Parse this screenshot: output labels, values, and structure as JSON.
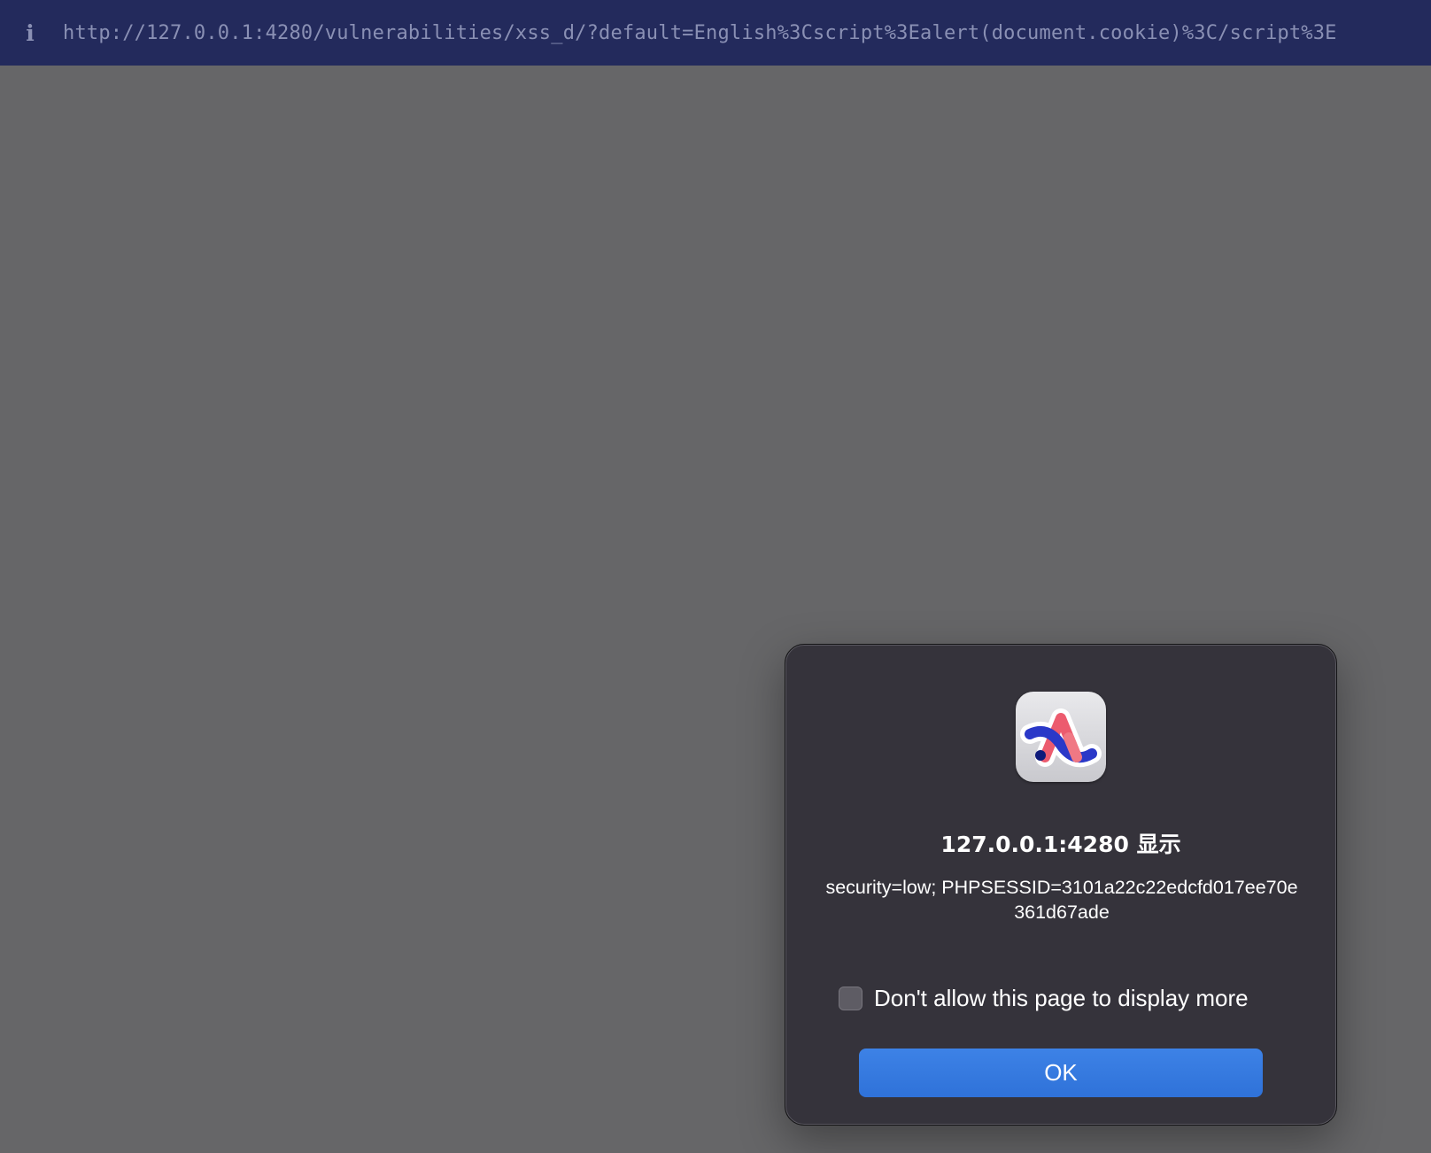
{
  "address_bar": {
    "info_icon": "i",
    "url": "http://127.0.0.1:4280/vulnerabilities/xss_d/?default=English%3Cscript%3Ealert(document.cookie)%3C/script%3E"
  },
  "alert_dialog": {
    "app_icon": "arc-browser-icon",
    "title": "127.0.0.1:4280 显示",
    "message": "security=low; PHPSESSID=3101a22c22edcfd017ee70e361d67ade",
    "checkbox_label": "Don't allow this page to display more",
    "checkbox_checked": false,
    "ok_label": "OK"
  },
  "colors": {
    "address_bar_bg": "#232a5c",
    "page_bg": "#666668",
    "dialog_bg": "#35333b",
    "button_bg": "#3078dc"
  }
}
